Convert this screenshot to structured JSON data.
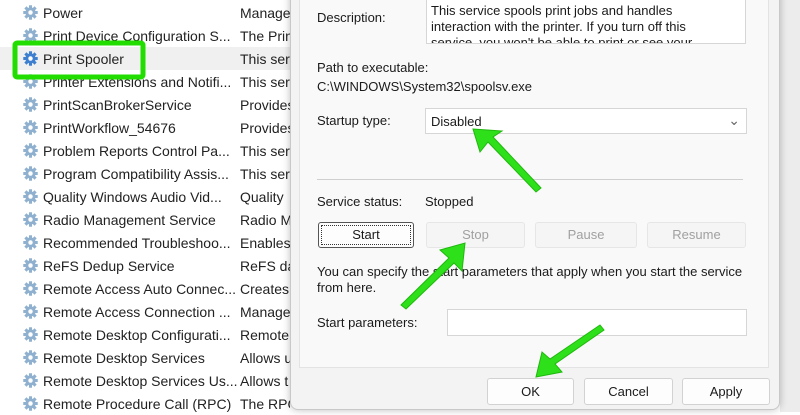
{
  "services": [
    {
      "name": "Power",
      "desc": "Manage"
    },
    {
      "name": "Print Device Configuration S...",
      "desc": "The Prin"
    },
    {
      "name": "Print Spooler",
      "desc": "This serv",
      "selected": true
    },
    {
      "name": "Printer Extensions and Notifi...",
      "desc": "This serv"
    },
    {
      "name": "PrintScanBrokerService",
      "desc": "Provides"
    },
    {
      "name": "PrintWorkflow_54676",
      "desc": "Provides"
    },
    {
      "name": "Problem Reports Control Pa...",
      "desc": "This serv"
    },
    {
      "name": "Program Compatibility Assis...",
      "desc": "This serv"
    },
    {
      "name": "Quality Windows Audio Vid...",
      "desc": "Quality"
    },
    {
      "name": "Radio Management Service",
      "desc": "Radio M"
    },
    {
      "name": "Recommended Troubleshoo...",
      "desc": "Enables"
    },
    {
      "name": "ReFS Dedup Service",
      "desc": "ReFS da"
    },
    {
      "name": "Remote Access Auto Connec...",
      "desc": "Creates"
    },
    {
      "name": "Remote Access Connection ...",
      "desc": "Manage"
    },
    {
      "name": "Remote Desktop Configurati...",
      "desc": "Remote"
    },
    {
      "name": "Remote Desktop Services",
      "desc": "Allows u"
    },
    {
      "name": "Remote Desktop Services Us...",
      "desc": "Allows t"
    },
    {
      "name": "Remote Procedure Call (RPC)",
      "desc": "The RPC"
    }
  ],
  "dialog": {
    "description_label": "Description:",
    "description_text": "This service spools print jobs and handles interaction with the printer.  If you turn off this service, you won't be able to print or see your printers.",
    "path_label": "Path to executable:",
    "path_value": "C:\\WINDOWS\\System32\\spoolsv.exe",
    "startup_label": "Startup type:",
    "startup_value": "Disabled",
    "status_label": "Service status:",
    "status_value": "Stopped",
    "start": "Start",
    "stop": "Stop",
    "pause": "Pause",
    "resume": "Resume",
    "hint": "You can specify the start parameters that apply when you start the service from here.",
    "params_label": "Start parameters:",
    "params_value": "",
    "ok": "OK",
    "cancel": "Cancel",
    "apply": "Apply"
  },
  "colors": {
    "highlight": "#22dd00",
    "gear": "#4a88c8"
  }
}
